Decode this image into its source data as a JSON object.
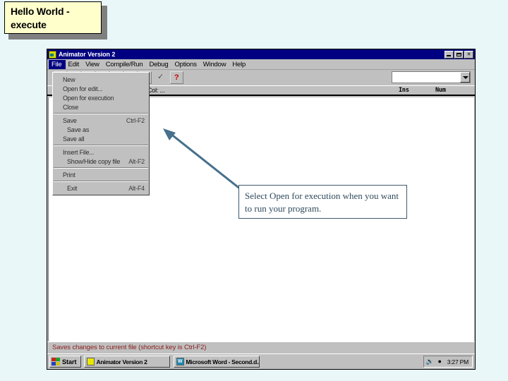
{
  "slide": {
    "title_line1": "Hello World -",
    "title_line2": "execute",
    "background_color": "#e9f7f9",
    "title_box_color": "#ffffcc"
  },
  "app_window": {
    "title": "Animator Version 2",
    "icon": "animator-icon",
    "window_buttons": [
      {
        "name": "minimize",
        "label": ""
      },
      {
        "name": "restore",
        "label": ""
      },
      {
        "name": "close",
        "label": "✕"
      }
    ],
    "menu_bar": [
      {
        "label": "File",
        "active": true
      },
      {
        "label": "Edit",
        "active": false
      },
      {
        "label": "View",
        "active": false
      },
      {
        "label": "Compile/Run",
        "active": false
      },
      {
        "label": "Debug",
        "active": false
      },
      {
        "label": "Options",
        "active": false
      },
      {
        "label": "Window",
        "active": false
      },
      {
        "label": "Help",
        "active": false
      }
    ],
    "toolbar": {
      "buttons": [
        {
          "name": "find-button",
          "glyph": "◌"
        },
        {
          "name": "run-button",
          "glyph": "✳"
        },
        {
          "name": "trace-button",
          "glyph": "◌"
        },
        {
          "name": "animate-button",
          "glyph": "✻"
        },
        {
          "name": "step-into-button",
          "glyph": "⤒"
        },
        {
          "name": "add-watch-button",
          "glyph": "≣"
        },
        {
          "name": "step-over-button",
          "glyph": "≡"
        },
        {
          "name": "check-button",
          "glyph": "✓"
        },
        {
          "name": "help-button",
          "glyph": "?"
        }
      ],
      "combo_value": "",
      "combo_placeholder": ""
    },
    "info_strip": {
      "column_label": "Col: ...",
      "insert_indicator": "Ins",
      "num_indicator": "Num"
    }
  },
  "file_menu": {
    "groups": [
      [
        {
          "label": "New",
          "shortcut": "",
          "indent": false
        },
        {
          "label": "Open for edit...",
          "shortcut": "",
          "indent": false
        },
        {
          "label": "Open for execution",
          "shortcut": "",
          "indent": false
        },
        {
          "label": "Close",
          "shortcut": "",
          "indent": false
        }
      ],
      [
        {
          "label": "Save",
          "shortcut": "Ctrl-F2",
          "indent": false
        },
        {
          "label": "Save as",
          "shortcut": "",
          "indent": true
        },
        {
          "label": "Save all",
          "shortcut": "",
          "indent": false
        }
      ],
      [
        {
          "label": "Insert File...",
          "shortcut": "",
          "indent": false
        },
        {
          "label": "Show/Hide copy file",
          "shortcut": "Alt-F2",
          "indent": true
        }
      ],
      [
        {
          "label": "Print",
          "shortcut": "",
          "indent": false
        }
      ],
      [
        {
          "label": "Exit",
          "shortcut": "Alt-F4",
          "indent": true
        }
      ]
    ]
  },
  "callout": {
    "text": "Select Open for execution when you want to run your program.",
    "border_color": "#3d5a6c",
    "text_color": "#2f4a5c",
    "arrow_color": "#46708c"
  },
  "status_bar": {
    "hint": "Saves changes to current file (shortcut key is Ctrl-F2)",
    "hint_color": "#8b2020"
  },
  "taskbar": {
    "start_label": "Start",
    "tasks": [
      {
        "label": "Animator Version 2",
        "icon": "animator-icon"
      },
      {
        "label": "Microsoft Word - Second.d...",
        "icon": "word-icon"
      }
    ],
    "tray": {
      "icons": [
        "volume-icon",
        "network-icon"
      ],
      "clock": "3:27 PM"
    }
  }
}
